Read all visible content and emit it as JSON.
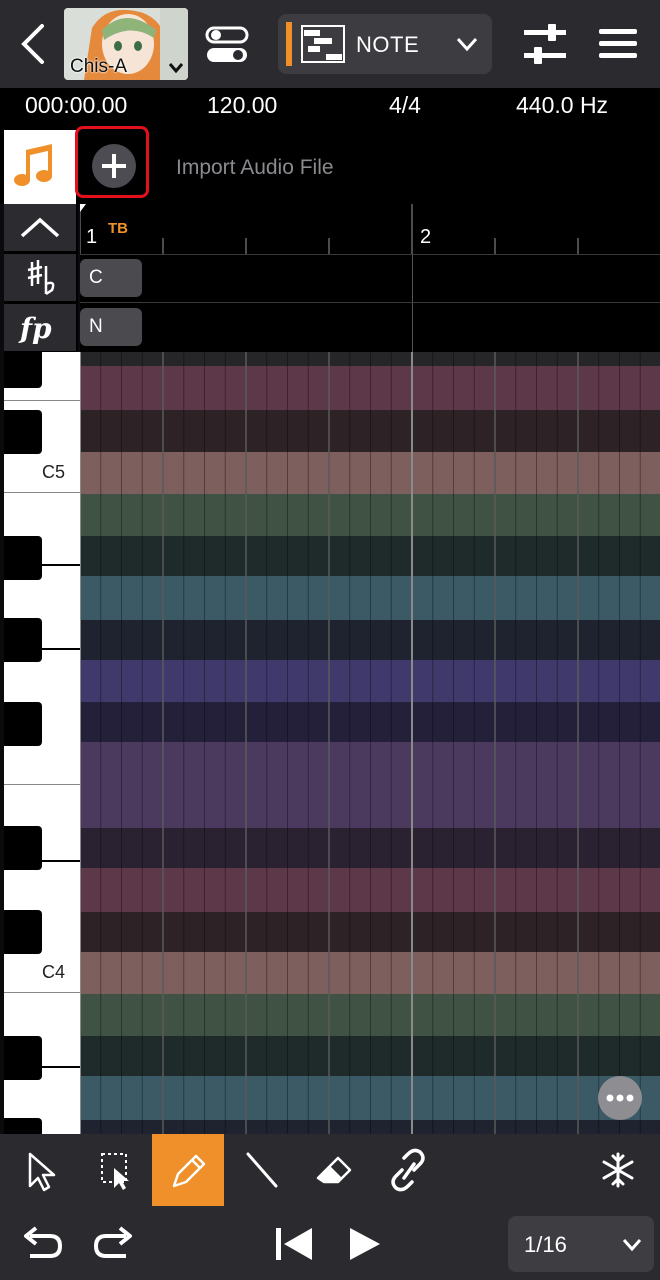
{
  "header": {
    "singer_name": "Chis-A",
    "mode_label": "NOTE"
  },
  "info_bar": {
    "time": "000:00.00",
    "tempo": "120.00",
    "time_signature": "4/4",
    "tuning": "440.0 Hz"
  },
  "audio_track": {
    "import_label": "Import Audio File"
  },
  "ruler": {
    "measures": [
      "1",
      "2"
    ],
    "tempo_marker": "TB"
  },
  "key_row": {
    "value": "C"
  },
  "dynamics_row": {
    "value": "N"
  },
  "keyboard": {
    "labels": [
      "C5",
      "C4"
    ]
  },
  "toolbar": {
    "quantize_label": "1/16"
  },
  "colors": {
    "accent": "#f0902a",
    "highlight": "#e4101c",
    "row_pink": "#5d3848",
    "row_salmon": "#7d5f5e",
    "row_green": "#3f5244",
    "row_teal": "#3b5a66",
    "row_indigo": "#3f3a6b",
    "row_purple": "#4b3a5e"
  },
  "icons": [
    "back-icon",
    "chevron-down-icon",
    "toggle-icon",
    "piano-roll-icon",
    "mixer-icon",
    "menu-icon",
    "music-note-icon",
    "plus-icon",
    "chevron-up-icon",
    "sharp-flat-icon",
    "fp-dynamics-icon",
    "more-icon",
    "arrow-select-icon",
    "box-select-icon",
    "pencil-icon",
    "line-icon",
    "eraser-icon",
    "link-icon",
    "snowflake-icon",
    "undo-icon",
    "redo-icon",
    "skip-back-icon",
    "play-icon"
  ]
}
